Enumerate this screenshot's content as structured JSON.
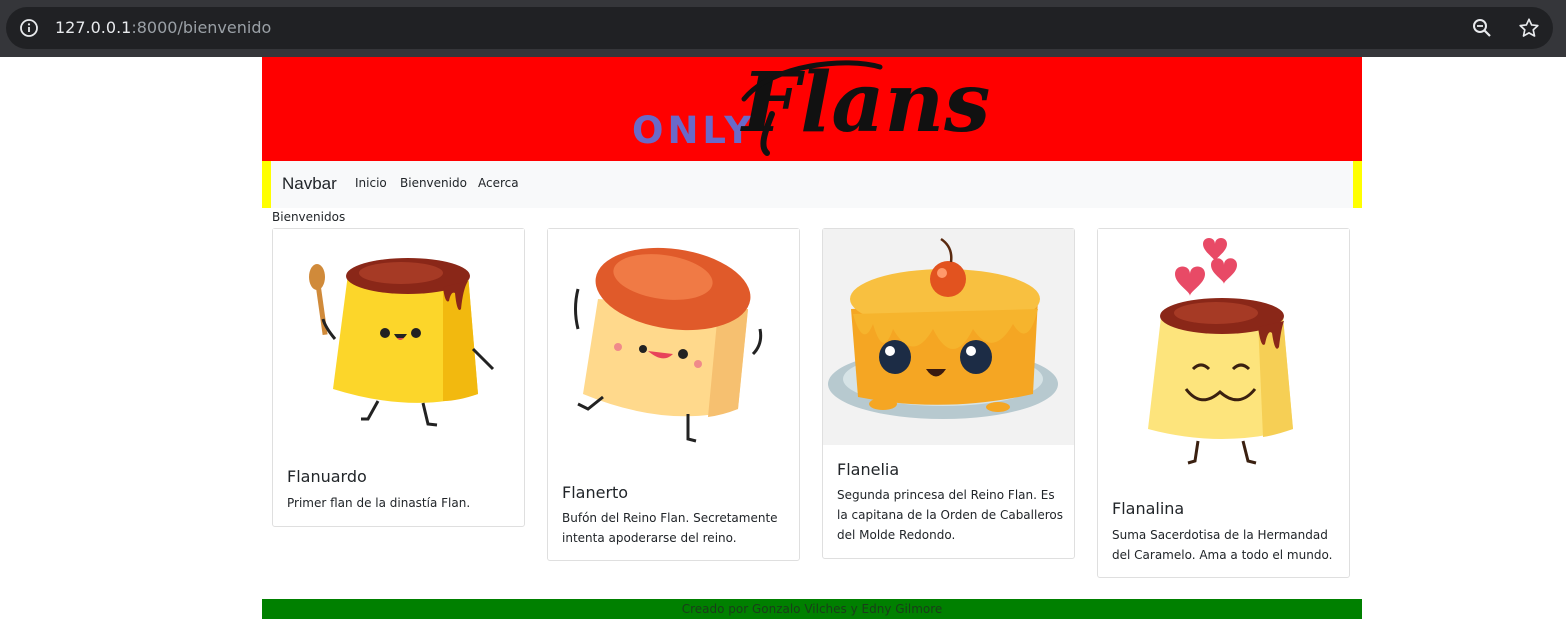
{
  "browser": {
    "url_host": "127.0.0.1",
    "url_rest": ":8000/bienvenido"
  },
  "header": {
    "logo_small": "ONLY",
    "logo_large": "Flans"
  },
  "navbar": {
    "brand": "Navbar",
    "links": [
      "Inicio",
      "Bienvenido",
      "Acerca"
    ]
  },
  "welcome": "Bienvenidos",
  "cards": [
    {
      "title": "Flanuardo",
      "text": "Primer flan de la dinastía Flan."
    },
    {
      "title": "Flanerto",
      "text": "Bufón del Reino Flan. Secretamente intenta apoderarse del reino."
    },
    {
      "title": "Flanelia",
      "text": "Segunda princesa del Reino Flan. Es la capitana de la Orden de Caballeros del Molde Redondo."
    },
    {
      "title": "Flanalina",
      "text": "Suma Sacerdotisa de la Hermandad del Caramelo. Ama a todo el mundo."
    }
  ],
  "footer": "Creado por Gonzalo Vilches y Edny Gilmore",
  "colors": {
    "header_bg": "#ff0000",
    "navbar_bg": "#f8f9fa",
    "navbar_edges": "#ffff00",
    "footer_bg": "#008000",
    "logo_only": "#6a6ac8"
  }
}
